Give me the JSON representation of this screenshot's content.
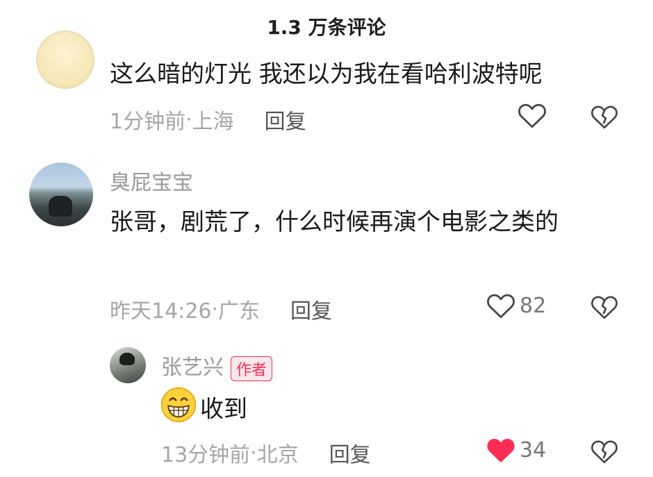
{
  "header": {
    "title": "1.3 万条评论"
  },
  "comments": [
    {
      "username": "",
      "content": "这么暗的灯光 我还以为我在看哈利波特呢",
      "time": "1分钟前",
      "location": "上海",
      "reply_label": "回复",
      "like_count": ""
    },
    {
      "username": "臭屁宝宝",
      "content": "张哥，剧荒了，什么时候再演个电影之类的",
      "time": "昨天14:26",
      "location": "广东",
      "reply_label": "回复",
      "like_count": "82"
    }
  ],
  "reply": {
    "username": "张艺兴",
    "author_badge": "作者",
    "content": "收到",
    "time": "13分钟前",
    "location": "北京",
    "reply_label": "回复",
    "like_count": "34",
    "liked": true
  },
  "separator": " · ",
  "colors": {
    "like_active": "#fe2c55",
    "badge_text": "#fe2c55",
    "meta": "#a6a6a6"
  },
  "icons": [
    "heart-icon",
    "dislike-icon",
    "grin-emoji-icon"
  ]
}
